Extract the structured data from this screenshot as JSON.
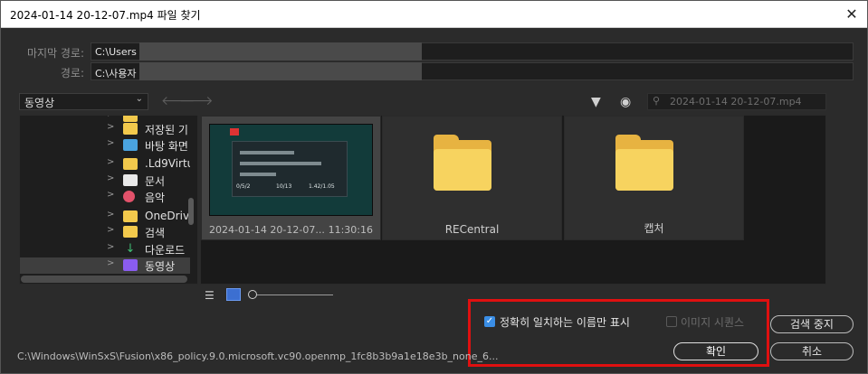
{
  "window": {
    "title": "2024-01-14 20-12-07.mp4 파일 찾기"
  },
  "paths": {
    "last_path_label": "마지막 경로:",
    "last_path_value": "C:\\Users",
    "path_label": "경로:",
    "path_value": "C:\\사용자"
  },
  "location": {
    "selected": "동영상"
  },
  "search": {
    "placeholder": "2024-01-14 20-12-07.mp4"
  },
  "tree": {
    "items": [
      {
        "label": "저장된 기",
        "icon": "folder-icon"
      },
      {
        "label": "바탕 화면",
        "icon": "desktop-icon"
      },
      {
        "label": ".Ld9Virtu",
        "icon": "folder-icon"
      },
      {
        "label": "문서",
        "icon": "documents-icon"
      },
      {
        "label": "음악",
        "icon": "music-icon"
      },
      {
        "label": "OneDrive",
        "icon": "folder-icon"
      },
      {
        "label": "검색",
        "icon": "folder-icon"
      },
      {
        "label": "다운로드",
        "icon": "download-icon"
      },
      {
        "label": "동영상",
        "icon": "videos-icon",
        "selected": true
      }
    ]
  },
  "files": [
    {
      "name": "2024-01-14 20-12-07...",
      "time": "11:30:16",
      "type": "video",
      "selected": true
    },
    {
      "name": "RECentral",
      "type": "folder"
    },
    {
      "name": "캡처",
      "type": "folder"
    }
  ],
  "thumbnail": {
    "stats": [
      "0/5/2",
      "10/13",
      "1.42/1.05"
    ]
  },
  "options": {
    "exact_match_label": "정확히 일치하는 이름만 표시",
    "exact_match_checked": true,
    "image_sequence_label": "이미지 시퀀스",
    "image_sequence_checked": false
  },
  "buttons": {
    "stop_search": "검색 중지",
    "ok": "확인",
    "cancel": "취소"
  },
  "status_path": "C:\\Windows\\WinSxS\\Fusion\\x86_policy.9.0.microsoft.vc90.openmp_1fc8b3b9a1e18e3b_none_6...",
  "colors": {
    "accent": "#3a8ee6",
    "highlight_box": "#e01010",
    "folder": "#f7d35f"
  }
}
